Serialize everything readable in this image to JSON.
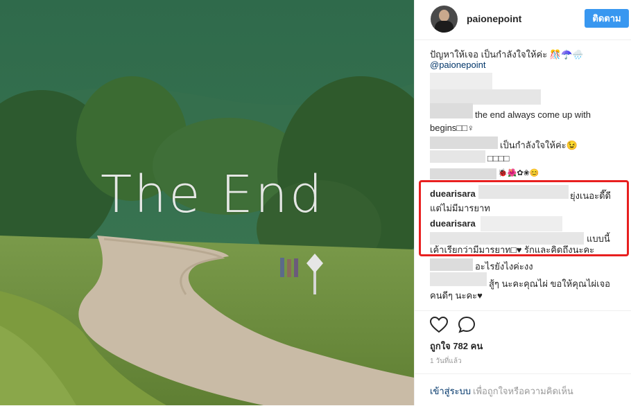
{
  "photo": {
    "overlay_text": "The End"
  },
  "header": {
    "username": "paionepoint",
    "follow_label": "ติดตาม"
  },
  "caption": {
    "text": "ปัญหาให้เจอ เป็นกำลังใจให้ค่ะ 🎊☂️🌧️",
    "mention": "@paionepoint"
  },
  "comments": [
    {
      "text": "the end always come up with"
    },
    {
      "text": "begins□□♀"
    },
    {
      "text": "เป็นกำลังใจให้ค่ะ😉"
    },
    {
      "text": "□□□□"
    },
    {
      "text": "🐞🌺✿❀😊"
    },
    {
      "user": "duearisara",
      "text": "ยุ่งเนอะดี๊ดี",
      "text2": "แต่ไม่มีมารยาท"
    },
    {
      "user": "duearisara",
      "text": "แบบนี้",
      "text2": "เค้าเรียกว่ามีมารยาท□♥ รักและคิดถึงนะคะ"
    },
    {
      "text": "อะไรยังไงค่ะงง"
    },
    {
      "text": "สู้ๆ นะคะคุณไผ่ ขอให้คุณไผ่เจอ",
      "text2": "คนดีๆ นะคะ♥"
    }
  ],
  "actions": {
    "likes": "ถูกใจ 782 คน",
    "time": "1 วันที่แล้ว"
  },
  "login": {
    "link": "เข้าสู่ระบบ",
    "rest": "เพื่อถูกใจหรือความคิดเห็น"
  },
  "icons": {
    "like": "heart-icon",
    "comment": "comment-icon"
  },
  "colors": {
    "accent": "#3897f0",
    "highlight": "#e81f1f",
    "link": "#003569"
  }
}
